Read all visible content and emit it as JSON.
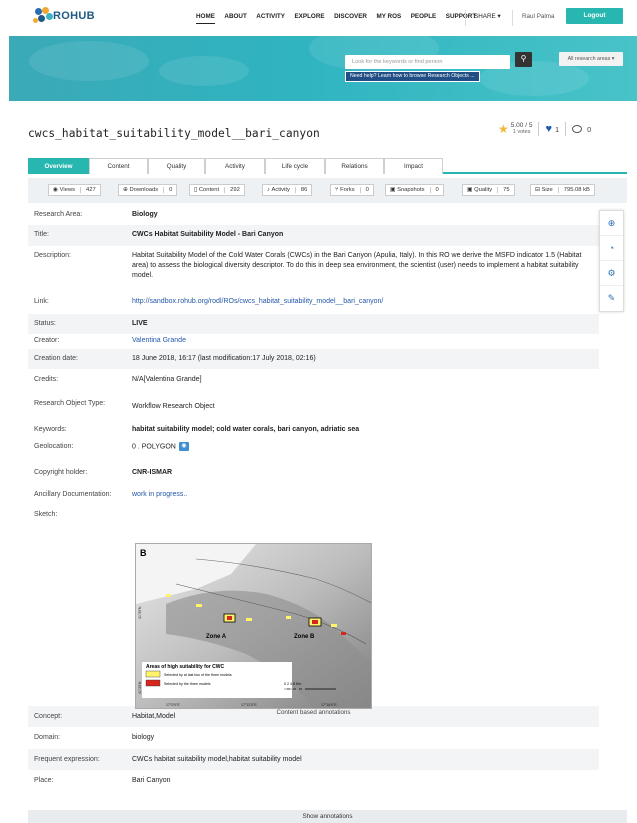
{
  "brand": {
    "name": "ROHUB"
  },
  "nav": {
    "items": [
      "HOME",
      "ABOUT",
      "ACTIVITY",
      "EXPLORE",
      "DISCOVER",
      "MY ROS",
      "PEOPLE",
      "SUPPORT"
    ],
    "share_label": "SHARE ▾",
    "user": "Raul Palma",
    "logout_label": "Logout"
  },
  "search": {
    "placeholder": "Look for the keywords or find person",
    "help_link": "Need help? Learn how to browse Research Objects ...",
    "area_select": "All research areas ▾"
  },
  "ro": {
    "title": "cwcs_habitat_suitability_model__bari_canyon",
    "rating": "5.00 / 5",
    "votes": "1 votes",
    "likes": "1",
    "comments": "0"
  },
  "tabs": [
    "Overview",
    "Content",
    "Quality",
    "Activity",
    "Life cycle",
    "Relations",
    "Impact"
  ],
  "stats": [
    {
      "icon": "eye-icon",
      "glyph": "👁",
      "label": "Views",
      "value": "427"
    },
    {
      "icon": "download-icon",
      "glyph": "⊕",
      "label": "Downloads",
      "value": "0"
    },
    {
      "icon": "file-icon",
      "glyph": "🗋",
      "label": "Content",
      "value": "292"
    },
    {
      "icon": "bell-icon",
      "glyph": "♫",
      "label": "Activity",
      "value": "86"
    },
    {
      "icon": "fork-icon",
      "glyph": "⑂",
      "label": "Forks",
      "value": "0"
    },
    {
      "icon": "camera-icon",
      "glyph": "▣",
      "label": "Snapshots",
      "value": "0"
    },
    {
      "icon": "quality-icon",
      "glyph": "▣",
      "label": "Quality",
      "value": "75"
    },
    {
      "icon": "size-icon",
      "glyph": "⊟",
      "label": "Size",
      "value": "795.08 kB"
    }
  ],
  "meta": {
    "research_area": {
      "label": "Research Area:",
      "value": "Biology"
    },
    "title": {
      "label": "Title:",
      "value": "CWCs Habitat Suitability Model - Bari Canyon"
    },
    "description": {
      "label": "Description:",
      "value": "Habitat Suitability Model of the Cold Water Corals (CWCs) in the Bari Canyon (Apulia, Italy). In this RO we derive the MSFD indicator 1.5 (Habitat area) to assess the biological diversity descriptor. To do this in deep sea environment, the scientist (user) needs to implement a habitat suitability model."
    },
    "link": {
      "label": "Link:",
      "value": "http://sandbox.rohub.org/rodl/ROs/cwcs_habitat_suitability_model__bari_canyon/"
    },
    "status": {
      "label": "Status:",
      "value": "LIVE"
    },
    "creator": {
      "label": "Creator:",
      "value": "Valentina Grande"
    },
    "creation_date": {
      "label": "Creation date:",
      "value": "18 June 2018, 16:17 (last modification:17 July 2018, 02:16)"
    },
    "credits": {
      "label": "Credits:",
      "value": "N/A[Valentina Grande]"
    },
    "ro_type": {
      "label": "Research Object Type:",
      "value": "Workflow Research Object"
    },
    "keywords": {
      "label": "Keywords:",
      "value": "habitat suitability model; cold water corals, bari canyon, adriatic sea"
    },
    "geolocation": {
      "label": "Geolocation:",
      "value": "0 . POLYGON"
    },
    "copyright": {
      "label": "Copyright holder:",
      "value": "CNR-ISMAR"
    },
    "ancillary": {
      "label": "Ancillary Documentation:",
      "value": "work in progress.."
    },
    "sketch": {
      "label": "Sketch:"
    },
    "concept": {
      "label": "Concept:",
      "value": "Habitat,Model"
    },
    "domain": {
      "label": "Domain:",
      "value": "biology"
    },
    "frequent": {
      "label": "Frequent expression:",
      "value": "CWCs habitat suitability model,habitat suitability model"
    },
    "place": {
      "label": "Place:",
      "value": "Bari Canyon"
    }
  },
  "sketch_fig": {
    "panel": "B",
    "zone_a": "Zone A",
    "zone_b": "Zone B",
    "lat1": "41°35'N",
    "lat2": "41°25'N",
    "legend_title": "Areas of high suitability for CWC",
    "legend1": "Selected by at last two of the three models",
    "legend2": "Selected by the three models",
    "scale": "0   2   4        8 Km",
    "lon1": "17°0'0\"E",
    "lon2": "17°12'0\"E",
    "lon3": "17°18'0\"E",
    "colors": {
      "yellow": "#fff36b",
      "red": "#d7261e"
    }
  },
  "caption": "Content based annotations",
  "show_annotations": "Show annotations",
  "colors": {
    "accent": "#27b7b0",
    "link": "#2457a8",
    "nav_blue": "#214f85"
  }
}
